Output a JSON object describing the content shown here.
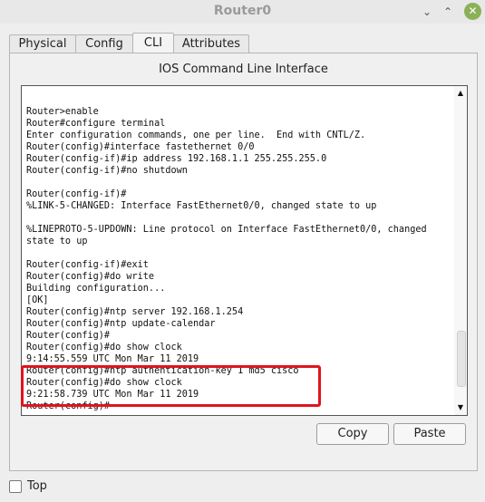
{
  "window": {
    "title": "Router0",
    "controls": {
      "minimize": "⌄",
      "maximize": "⌃",
      "close": "✕"
    }
  },
  "tabs": [
    {
      "label": "Physical",
      "active": false
    },
    {
      "label": "Config",
      "active": false
    },
    {
      "label": "CLI",
      "active": true
    },
    {
      "label": "Attributes",
      "active": false
    }
  ],
  "panel": {
    "heading": "IOS Command Line Interface"
  },
  "console": {
    "lines": [
      "Router>enable",
      "Router#configure terminal",
      "Enter configuration commands, one per line.  End with CNTL/Z.",
      "Router(config)#interface fastethernet 0/0",
      "Router(config-if)#ip address 192.168.1.1 255.255.255.0",
      "Router(config-if)#no shutdown",
      "",
      "Router(config-if)#",
      "%LINK-5-CHANGED: Interface FastEthernet0/0, changed state to up",
      "",
      "%LINEPROTO-5-UPDOWN: Line protocol on Interface FastEthernet0/0, changed",
      "state to up",
      "",
      "Router(config-if)#exit",
      "Router(config)#do write",
      "Building configuration...",
      "[OK]",
      "Router(config)#ntp server 192.168.1.254",
      "Router(config)#ntp update-calendar",
      "Router(config)#",
      "Router(config)#do show clock",
      "9:14:55.559 UTC Mon Mar 11 2019",
      "Router(config)#ntp authentication-key 1 md5 cisco",
      "Router(config)#do show clock",
      "9:21:58.739 UTC Mon Mar 11 2019",
      "Router(config)#"
    ],
    "highlight_color": "#e0141d"
  },
  "buttons": {
    "copy": "Copy",
    "paste": "Paste"
  },
  "footer": {
    "top_label": "Top",
    "top_checked": false
  }
}
